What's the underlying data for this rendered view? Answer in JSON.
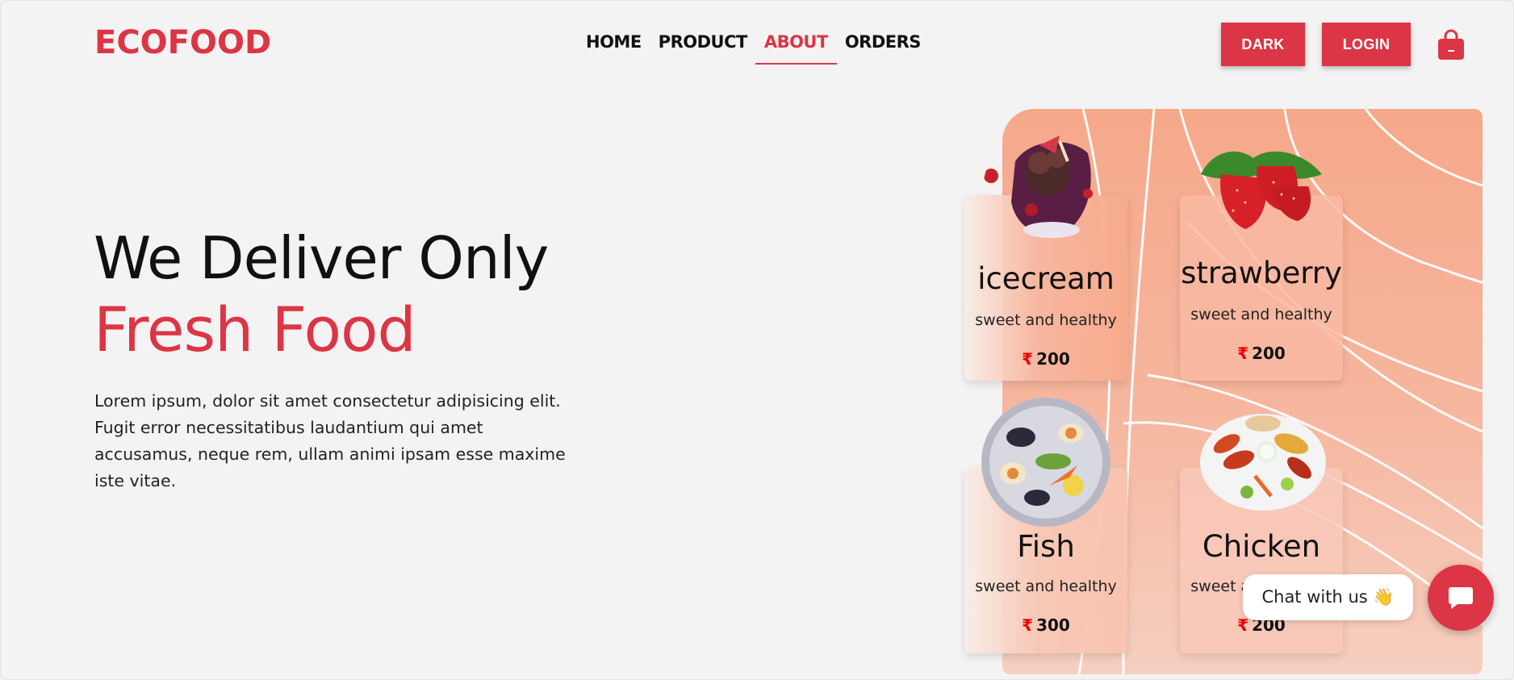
{
  "header": {
    "logo": "ECOFOOD",
    "nav": [
      {
        "label": "HOME"
      },
      {
        "label": "PRODUCT"
      },
      {
        "label": "ABOUT",
        "active": true
      },
      {
        "label": "ORDERS"
      }
    ],
    "dark_button": "DARK",
    "login_button": "LOGIN"
  },
  "hero": {
    "title_line1": "We Deliver Only",
    "title_line2": "Fresh Food",
    "description": "Lorem ipsum, dolor sit amet consectetur adipisicing elit. Fugit error necessitatibus laudantium qui amet accusamus, neque rem, ullam animi ipsam esse maxime iste vitae."
  },
  "products": [
    {
      "name": "icecream",
      "subtitle": "sweet and healthy",
      "currency": "₹",
      "price": "200"
    },
    {
      "name": "strawberry",
      "subtitle": "sweet and healthy",
      "currency": "₹",
      "price": "200"
    },
    {
      "name": "Fish",
      "subtitle": "sweet and healthy",
      "currency": "₹",
      "price": "300"
    },
    {
      "name": "Chicken",
      "subtitle": "sweet and healthy",
      "currency": "₹",
      "price": "200"
    }
  ],
  "chat": {
    "label": "Chat with us 👋"
  },
  "colors": {
    "accent": "#dc3545",
    "background": "#f3f3f3",
    "panel": "#f6a88a"
  },
  "icons": {
    "cart": "shopping-bag-icon",
    "chat": "chat-bubble-icon"
  }
}
